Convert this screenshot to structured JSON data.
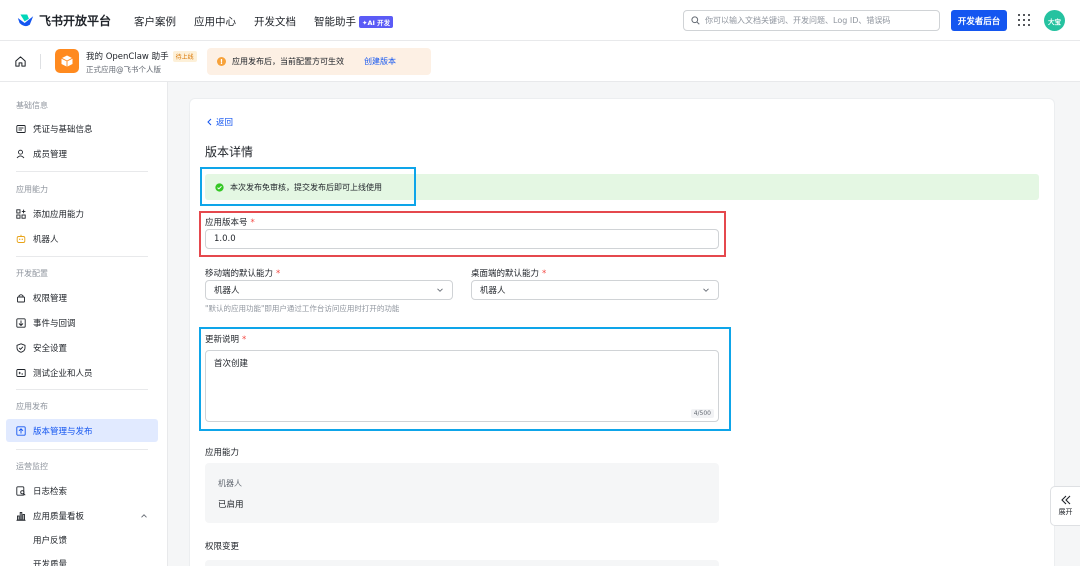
{
  "topnav": {
    "brand": "飞书开放平台",
    "links": [
      "客户案例",
      "应用中心",
      "开发文档",
      "智能助手"
    ],
    "ai_badge": "✦AI 开发",
    "search_placeholder": "你可以输入文档关键词、开发问题、Log ID、错误码",
    "dev_console": "开发者后台",
    "avatar": "大宝"
  },
  "app": {
    "name": "我的 OpenClaw 助手",
    "status_badge": "待上线",
    "subtitle": "正式应用@飞书个人版"
  },
  "notice": {
    "text": "应用发布后，当前配置方可生效",
    "link": "创建版本"
  },
  "sidebar": {
    "groups": [
      {
        "title": "基础信息",
        "items": [
          "凭证与基础信息",
          "成员管理"
        ]
      },
      {
        "title": "应用能力",
        "items": [
          "添加应用能力",
          "机器人"
        ]
      },
      {
        "title": "开发配置",
        "items": [
          "权限管理",
          "事件与回调",
          "安全设置",
          "测试企业和人员"
        ]
      },
      {
        "title": "应用发布",
        "items": [
          "版本管理与发布"
        ]
      },
      {
        "title": "运营监控",
        "items": [
          "日志检索",
          "应用质量看板",
          "用户反馈",
          "开发质量"
        ]
      }
    ]
  },
  "main": {
    "back": "返回",
    "title": "版本详情",
    "success": "本次发布免审核，提交发布后即可上线使用",
    "version_label": "应用版本号",
    "version_value": "1.0.0",
    "mobile_label": "移动端的默认能力",
    "mobile_value": "机器人",
    "desktop_label": "桌面端的默认能力",
    "desktop_value": "机器人",
    "hint": "\"默认的应用功能\"即用户通过工作台访问应用时打开的功能",
    "notes_label": "更新说明",
    "notes_value": "首次创建",
    "notes_counter": "4/500",
    "capability_title": "应用能力",
    "capability_name": "机器人",
    "capability_status": "已启用",
    "permission_title": "权限变更"
  },
  "expand": {
    "label": "展开"
  },
  "colors": {
    "primary": "#1456f0",
    "success_bg": "#e4f7e3",
    "annotation_red": "#e5484d",
    "annotation_blue": "#0ea5e9"
  }
}
